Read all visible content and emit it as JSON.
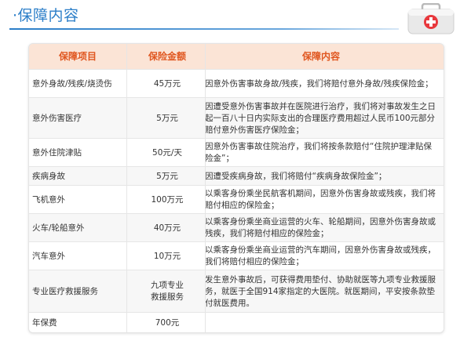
{
  "header": {
    "title": "·保障内容"
  },
  "table": {
    "columns": [
      "保障项目",
      "保险金额",
      "保障内容"
    ],
    "rows": [
      {
        "item": "意外身故/残疾/烧烫伤",
        "amount": "45万元",
        "content": "因意外伤害事故身故/残疾，我们将赔付意外身故/残疾保险金；"
      },
      {
        "item": "意外伤害医疗",
        "amount": "5万元",
        "content": "因遭受意外伤害事故并在医院进行治疗，我们将对事故发生之日起一百八十日内实际支出的合理医疗费用超过人民币100元部分赔付意外伤害医疗保险金；"
      },
      {
        "item": "意外住院津贴",
        "amount": "50元/天",
        "content": "因意外伤害事故住院治疗，我们将按条款赔付“住院护理津贴保险金”；"
      },
      {
        "item": "疾病身故",
        "amount": "5万元",
        "content": "因遭受疾病身故，我们将赔付“疾病身故保险金”；"
      },
      {
        "item": "飞机意外",
        "amount": "100万元",
        "content": "以乘客身份乘坐民航客机期间，因意外伤害身故或残疾，我们将赔付相应的保险金；"
      },
      {
        "item": "火车/轮船意外",
        "amount": "40万元",
        "content": "以乘客身份乘坐商业运营的火车、轮船期间，因意外伤害身故或残疾，我们将赔付相应的保险金；"
      },
      {
        "item": "汽车意外",
        "amount": "10万元",
        "content": "以乘客身份乘坐商业运营的汽车期间，因意外伤害身故或残疾，我们将赔付相应的保险金；"
      },
      {
        "item": "专业医疗救援服务",
        "amount": "九项专业\n救援服务",
        "content": "发生意外事故后，可获得费用垫付、协助就医等九项专业救援服务，就医于全国914家指定的大医院。就医期间，平安按条款垫付就医费用。"
      },
      {
        "item": "年保费",
        "amount": "700元",
        "content": ""
      }
    ]
  }
}
